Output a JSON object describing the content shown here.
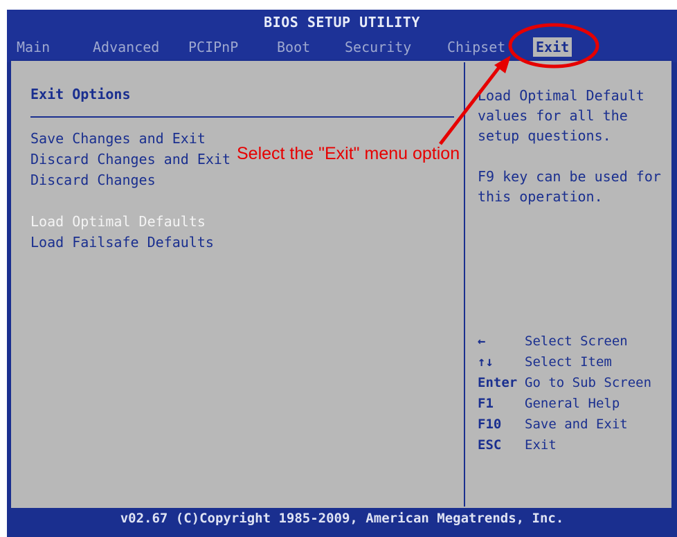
{
  "title": "BIOS SETUP UTILITY",
  "menu": [
    "Main",
    "Advanced",
    "PCIPnP",
    "Boot",
    "Security",
    "Chipset",
    "Exit"
  ],
  "active_menu": "Exit",
  "left": {
    "heading": "Exit Options",
    "options": [
      "Save Changes and Exit",
      "Discard Changes and Exit",
      "Discard Changes",
      "Load Optimal Defaults",
      "Load Failsafe Defaults"
    ],
    "highlighted": "Load Optimal Defaults"
  },
  "help": {
    "lines": [
      "Load Optimal Default values for all the setup questions.",
      "F9 key can be used for this operation."
    ]
  },
  "keys": [
    {
      "key": "←",
      "action": "Select Screen"
    },
    {
      "key": "↑↓",
      "action": "Select Item"
    },
    {
      "key": "Enter",
      "action": "Go to Sub Screen"
    },
    {
      "key": "F1",
      "action": "General Help"
    },
    {
      "key": "F10",
      "action": "Save and Exit"
    },
    {
      "key": "ESC",
      "action": "Exit"
    }
  ],
  "footer": "v02.67 (C)Copyright 1985-2009, American Megatrends, Inc.",
  "annotation": {
    "text": "Select the \"Exit\" menu option",
    "color": "#e60000"
  },
  "colors": {
    "background": "#1a2f8f",
    "panel": "#b8b8b8",
    "text": "#1a2f8f"
  }
}
